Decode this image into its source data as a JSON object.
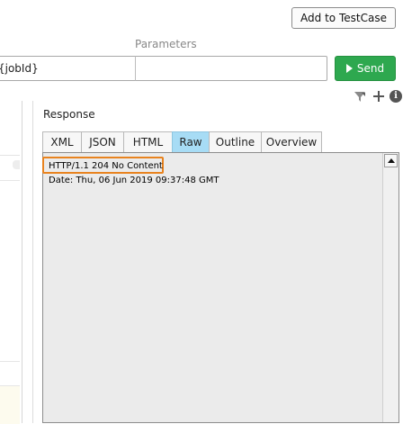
{
  "toolbar": {
    "add_to_testcase_label": "Add to TestCase"
  },
  "request": {
    "parameters_label": "Parameters",
    "url_value": "{jobId}",
    "params_value": "",
    "send_label": "Send"
  },
  "icons": {
    "filter": "filter-icon",
    "plus": "plus-icon",
    "info": "info-icon"
  },
  "response": {
    "label": "Response",
    "tabs": [
      {
        "label": "XML"
      },
      {
        "label": "JSON"
      },
      {
        "label": "HTML"
      },
      {
        "label": "Raw",
        "active": true
      },
      {
        "label": "Outline"
      },
      {
        "label": "Overview"
      }
    ],
    "raw_lines": [
      "HTTP/1.1 204 No Content",
      "Date: Thu, 06 Jun 2019 09:37:48 GMT"
    ]
  },
  "colors": {
    "send_green": "#2ea84f",
    "active_tab": "#a7dcf5",
    "highlight_orange": "#e8831f",
    "content_bg": "#ebebeb"
  }
}
